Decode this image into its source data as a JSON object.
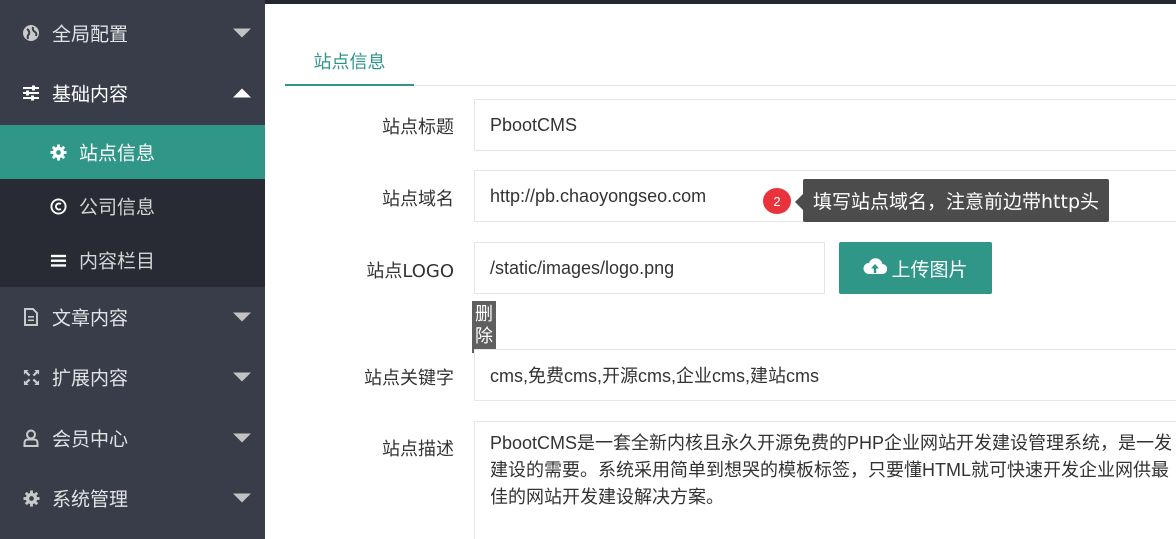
{
  "sidebar": {
    "global_config": "全局配置",
    "basic_content": "基础内容",
    "sub": {
      "site_info": "站点信息",
      "company_info": "公司信息",
      "content_column": "内容栏目"
    },
    "article_content": "文章内容",
    "extended_content": "扩展内容",
    "member_center": "会员中心",
    "system_management": "系统管理",
    "icons": [
      "globe-icon",
      "sliders-icon",
      "gear-icon",
      "copyright-icon",
      "list-icon",
      "document-icon",
      "expand-icon",
      "user-icon",
      "gear-icon"
    ]
  },
  "tabs": {
    "site_info": "站点信息"
  },
  "form": {
    "title_label": "站点标题",
    "title_value": "PbootCMS",
    "domain_label": "站点域名",
    "domain_value": "http://pb.chaoyongseo.com",
    "logo_label": "站点LOGO",
    "logo_value": "/static/images/logo.png",
    "upload_label": "上传图片",
    "delete_label": "删除",
    "keywords_label": "站点关键字",
    "keywords_value": "cms,免费cms,开源cms,企业cms,建站cms",
    "desc_label": "站点描述",
    "desc_value": "PbootCMS是一套全新内核且永久开源免费的PHP企业网站开发建设管理系统，是一发建设的需要。系统采用简单到想哭的模板标签，只要懂HTML就可快速开发企业网供最佳的网站开发建设解决方案。"
  },
  "tooltip": {
    "badge": "2",
    "text": "填写站点域名，注意前边带http头"
  },
  "colors": {
    "sidebar_bg": "#393d49",
    "submenu_bg": "#282b33",
    "accent": "#2f9688",
    "tooltip_bg": "#4c4c4c",
    "badge": "#e8333b"
  }
}
